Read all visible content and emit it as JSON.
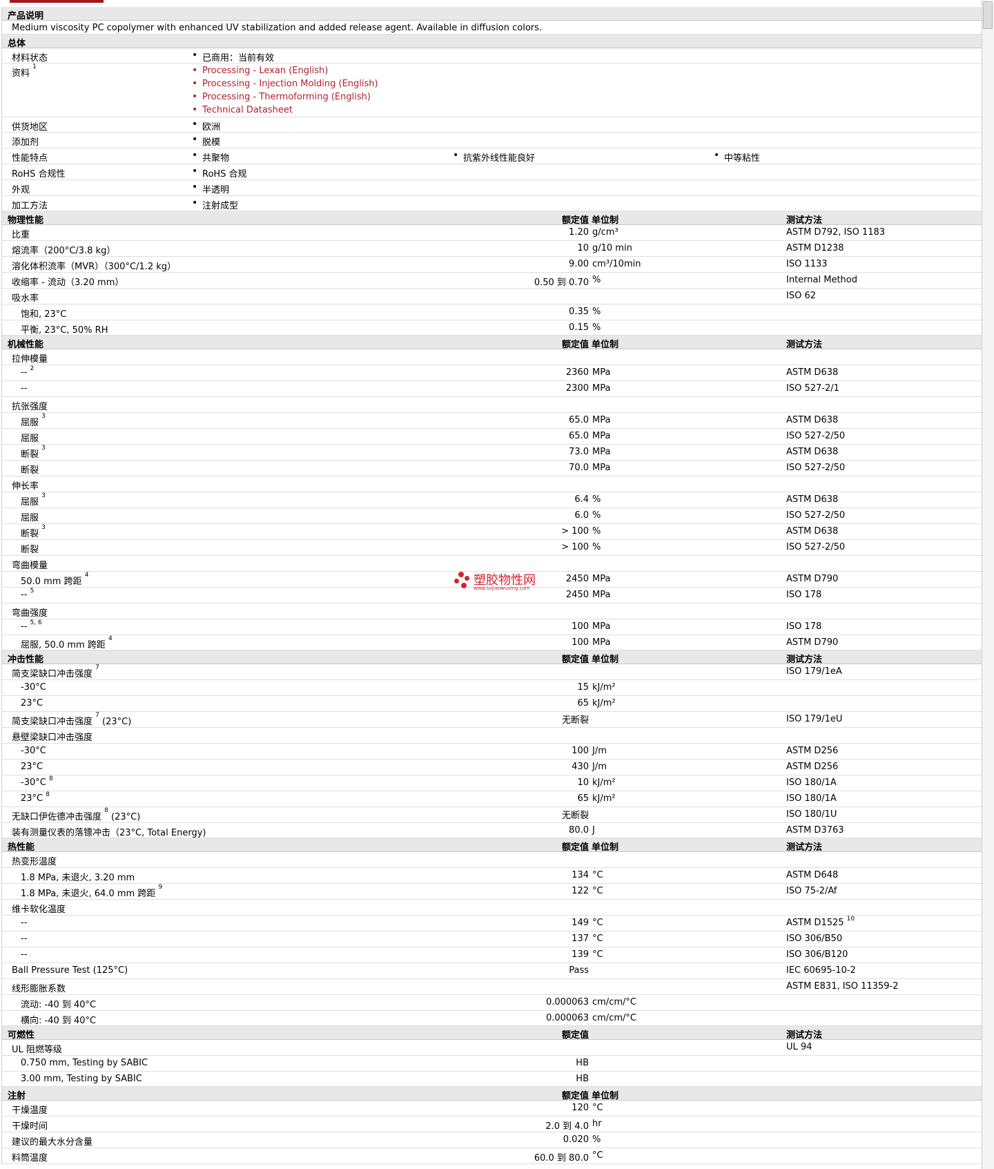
{
  "sections": {
    "desc_title": "产品说明",
    "desc_text": "Medium viscosity PC copolymer with enhanced UV stabilization and added release agent. Available in diffusion colors.",
    "general_title": "总体",
    "physical_title": "物理性能",
    "mechanical_title": "机械性能",
    "impact_title": "冲击性能",
    "thermal_title": "热性能",
    "flammability_title": "可燃性",
    "injection_title": "注射"
  },
  "headers": {
    "value": "额定值",
    "unit": "单位制",
    "method": "测试方法"
  },
  "general": {
    "status": {
      "label": "材料状态",
      "value": "已商用：当前有效"
    },
    "docs": {
      "label": "资料",
      "sup": "1",
      "links": [
        "Processing - Lexan (English)",
        "Processing - Injection Molding (English)",
        "Processing - Thermoforming (English)",
        "Technical Datasheet"
      ]
    },
    "region": {
      "label": "供货地区",
      "value": "欧洲"
    },
    "additive": {
      "label": "添加剂",
      "value": "脱模"
    },
    "features": {
      "label": "性能特点",
      "v1": "共聚物",
      "v2": "抗紫外线性能良好",
      "v3": "中等粘性"
    },
    "rohs": {
      "label": "RoHS 合规性",
      "value": "RoHS 合规"
    },
    "appearance": {
      "label": "外观",
      "value": "半透明"
    },
    "process": {
      "label": "加工方法",
      "value": "注射成型"
    }
  },
  "physical": {
    "r1": {
      "label": "比重",
      "value": "1.20",
      "unit": "g/cm³",
      "method": "ASTM D792, ISO 1183"
    },
    "r2": {
      "label": "熔流率（200°C/3.8 kg）",
      "value": "10",
      "unit": "g/10 min",
      "method": "ASTM D1238"
    },
    "r3": {
      "label": "溶化体积流率（MVR）（300°C/1.2 kg）",
      "value": "9.00",
      "unit": "cm³/10min",
      "method": "ISO 1133"
    },
    "r4": {
      "label": "收缩率 - 流动（3.20 mm）",
      "value": "0.50 到 0.70",
      "unit": "%",
      "method": "Internal Method"
    },
    "r5": {
      "label": "吸水率",
      "method": "ISO 62"
    },
    "r6": {
      "label": "饱和, 23°C",
      "value": "0.35",
      "unit": "%"
    },
    "r7": {
      "label": "平衡, 23°C, 50% RH",
      "value": "0.15",
      "unit": "%"
    }
  },
  "mechanical": {
    "r1": {
      "label": "拉伸模量"
    },
    "r2": {
      "label": "--",
      "sup": "2",
      "value": "2360",
      "unit": "MPa",
      "method": "ASTM D638"
    },
    "r3": {
      "label": "--",
      "value": "2300",
      "unit": "MPa",
      "method": "ISO 527-2/1"
    },
    "r4": {
      "label": "抗张强度"
    },
    "r5": {
      "label": "屈服",
      "sup": "3",
      "value": "65.0",
      "unit": "MPa",
      "method": "ASTM D638"
    },
    "r6": {
      "label": "屈服",
      "value": "65.0",
      "unit": "MPa",
      "method": "ISO 527-2/50"
    },
    "r7": {
      "label": "断裂",
      "sup": "3",
      "value": "73.0",
      "unit": "MPa",
      "method": "ASTM D638"
    },
    "r8": {
      "label": "断裂",
      "value": "70.0",
      "unit": "MPa",
      "method": "ISO 527-2/50"
    },
    "r9": {
      "label": "伸长率"
    },
    "r10": {
      "label": "屈服",
      "sup": "3",
      "value": "6.4",
      "unit": "%",
      "method": "ASTM D638"
    },
    "r11": {
      "label": "屈服",
      "value": "6.0",
      "unit": "%",
      "method": "ISO 527-2/50"
    },
    "r12": {
      "label": "断裂",
      "sup": "3",
      "value": "> 100",
      "unit": "%",
      "method": "ASTM D638"
    },
    "r13": {
      "label": "断裂",
      "value": "> 100",
      "unit": "%",
      "method": "ISO 527-2/50"
    },
    "r14": {
      "label": "弯曲模量"
    },
    "r15": {
      "label": "50.0 mm 跨距",
      "sup": "4",
      "value": "2450",
      "unit": "MPa",
      "method": "ASTM D790"
    },
    "r16": {
      "label": "--",
      "sup": "5",
      "value": "2450",
      "unit": "MPa",
      "method": "ISO 178"
    },
    "r17": {
      "label": "弯曲强度"
    },
    "r18": {
      "label": "--",
      "sup": "5, 6",
      "value": "100",
      "unit": "MPa",
      "method": "ISO 178"
    },
    "r19": {
      "label": "屈服, 50.0 mm 跨距",
      "sup": "4",
      "value": "100",
      "unit": "MPa",
      "method": "ASTM D790"
    }
  },
  "impact": {
    "r1": {
      "label": "简支梁缺口冲击强度",
      "sup": "7",
      "method": "ISO 179/1eA"
    },
    "r2": {
      "label": "-30°C",
      "value": "15",
      "unit": "kJ/m²"
    },
    "r3": {
      "label": "23°C",
      "value": "65",
      "unit": "kJ/m²"
    },
    "r4": {
      "label": "简支梁缺口冲击强度",
      "sup": "7",
      "suffix": "(23°C)",
      "value": "无断裂",
      "method": "ISO 179/1eU"
    },
    "r5": {
      "label": "悬壁梁缺口冲击强度"
    },
    "r6": {
      "label": "-30°C",
      "value": "100",
      "unit": "J/m",
      "method": "ASTM D256"
    },
    "r7": {
      "label": "23°C",
      "value": "430",
      "unit": "J/m",
      "method": "ASTM D256"
    },
    "r8": {
      "label": "-30°C",
      "sup": "8",
      "value": "10",
      "unit": "kJ/m²",
      "method": "ISO 180/1A"
    },
    "r9": {
      "label": "23°C",
      "sup": "8",
      "value": "65",
      "unit": "kJ/m²",
      "method": "ISO 180/1A"
    },
    "r10": {
      "label": "无缺口伊佐德冲击强度",
      "sup": "8",
      "suffix": "(23°C)",
      "value": "无断裂",
      "method": "ISO 180/1U"
    },
    "r11": {
      "label": "装有测量仪表的落镖冲击（23°C, Total Energy)",
      "value": "80.0",
      "unit": "J",
      "method": "ASTM D3763"
    }
  },
  "thermal": {
    "r1": {
      "label": "热变形温度"
    },
    "r2": {
      "label": "1.8 MPa, 未退火, 3.20 mm",
      "value": "134",
      "unit": "°C",
      "method": "ASTM D648"
    },
    "r3": {
      "label": "1.8 MPa, 未退火, 64.0 mm 跨距",
      "sup": "9",
      "value": "122",
      "unit": "°C",
      "method": "ISO 75-2/Af"
    },
    "r4": {
      "label": "维卡软化温度"
    },
    "r5": {
      "label": "--",
      "value": "149",
      "unit": "°C",
      "method": "ASTM D1525",
      "method_sup": "10"
    },
    "r6": {
      "label": "--",
      "value": "137",
      "unit": "°C",
      "method": "ISO 306/B50"
    },
    "r7": {
      "label": "--",
      "value": "139",
      "unit": "°C",
      "method": "ISO 306/B120"
    },
    "r8": {
      "label": "Ball Pressure Test (125°C)",
      "value": "Pass",
      "method": "IEC 60695-10-2"
    },
    "r9": {
      "label": "线形膨胀系数",
      "method": "ASTM E831, ISO 11359-2"
    },
    "r10": {
      "label": "流动: -40 到 40°C",
      "value": "0.000063",
      "unit": "cm/cm/°C"
    },
    "r11": {
      "label": "横向: -40 到 40°C",
      "value": "0.000063",
      "unit": "cm/cm/°C"
    }
  },
  "flammability": {
    "r1": {
      "label": "UL 阻燃等级",
      "method": "UL 94"
    },
    "r2": {
      "label": "0.750 mm, Testing by SABIC",
      "value": "HB"
    },
    "r3": {
      "label": "3.00 mm, Testing by SABIC",
      "value": "HB"
    }
  },
  "injection": {
    "r1": {
      "label": "干燥温度",
      "value": "120",
      "unit": "°C"
    },
    "r2": {
      "label": "干燥时间",
      "value": "2.0 到 4.0",
      "unit": "hr"
    },
    "r3": {
      "label": "建议的最大水分含量",
      "value": "0.020",
      "unit": "%"
    },
    "r4": {
      "label": "料筒温度",
      "value": "60.0 到 80.0",
      "unit": "°C"
    }
  },
  "watermark": {
    "text": "塑胶物性网",
    "url": "www.sujiaowuxing.com"
  },
  "colors": {
    "link": "#b01e2d",
    "section_bg": "#e8e8e8",
    "brand": "#a5141c",
    "watermark": "#d8212b"
  }
}
